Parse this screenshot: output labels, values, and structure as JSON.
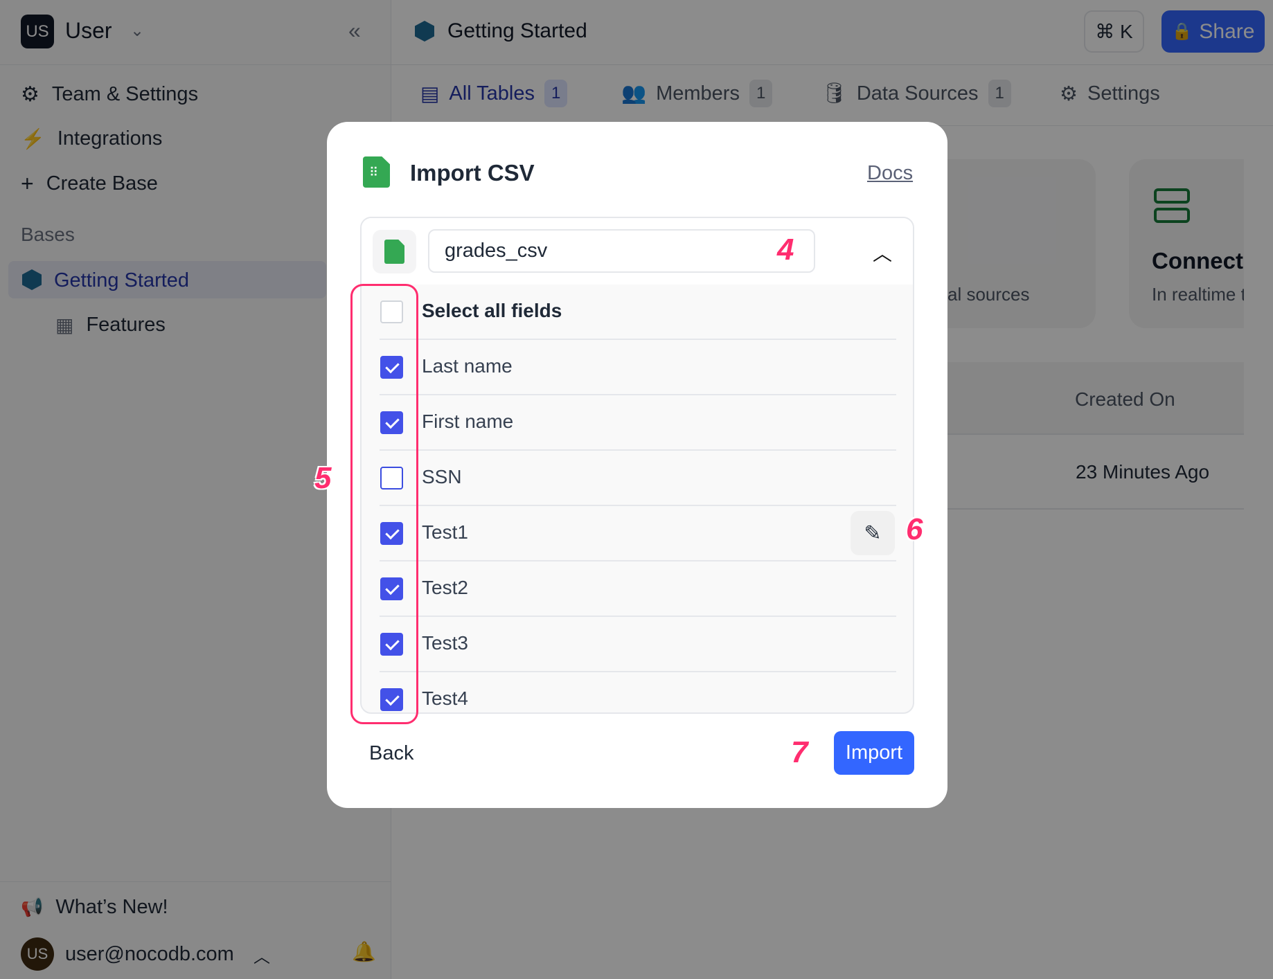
{
  "sidebar": {
    "avatar": "US",
    "user": "User",
    "items": [
      {
        "label": "Team & Settings",
        "icon": "gear-icon"
      },
      {
        "label": "Integrations",
        "icon": "plug-icon"
      },
      {
        "label": "Create Base",
        "icon": "plus-icon"
      }
    ],
    "section": "Bases",
    "base": "Getting Started",
    "table": "Features",
    "whats_new": "What’s New!",
    "email": "user@nocodb.com"
  },
  "header": {
    "title": "Getting Started",
    "shortcut": "⌘ K",
    "share": "Share"
  },
  "tabs": [
    {
      "label": "All Tables",
      "count": "1"
    },
    {
      "label": "Members",
      "count": "1"
    },
    {
      "label": "Data Sources",
      "count": "1"
    },
    {
      "label": "Settings"
    }
  ],
  "background": {
    "card1_text": "al sources",
    "card2_title": "Connect",
    "card2_text": "In realtime t",
    "col_header": "Created On",
    "row_value": "23 Minutes Ago"
  },
  "modal": {
    "title": "Import CSV",
    "docs": "Docs",
    "file_name": "grades_csv",
    "select_all": "Select all fields",
    "fields": [
      {
        "name": "Last name",
        "checked": true
      },
      {
        "name": "First name",
        "checked": true
      },
      {
        "name": "SSN",
        "checked": false
      },
      {
        "name": "Test1",
        "checked": true
      },
      {
        "name": "Test2",
        "checked": true
      },
      {
        "name": "Test3",
        "checked": true
      },
      {
        "name": "Test4",
        "checked": true
      }
    ],
    "back": "Back",
    "import": "Import"
  },
  "annotations": [
    "4",
    "5",
    "6",
    "7"
  ],
  "colors": {
    "accent": "#3366ff",
    "checkbox": "#4351e8",
    "annotation": "#ff2d6f",
    "sheet_icon": "#34a853"
  }
}
